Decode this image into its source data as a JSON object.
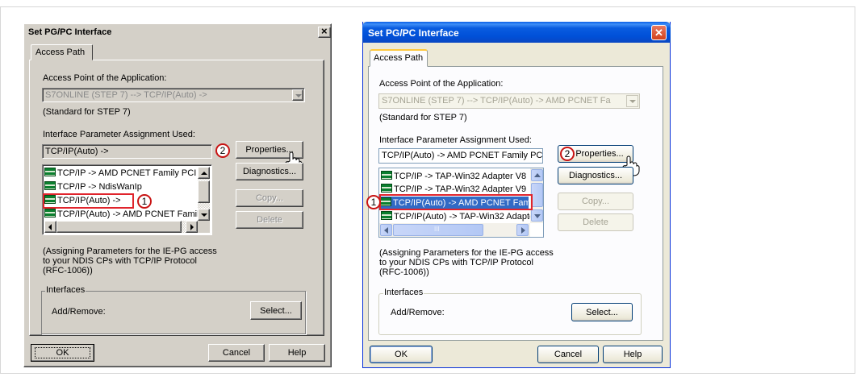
{
  "left_dialog": {
    "title": "Set PG/PC Interface",
    "close_glyph": "×",
    "tab": "Access Path",
    "access_point_label": "Access Point of the Application:",
    "access_point_value": "S7ONLINE      (STEP 7)      --> TCP/IP(Auto) ->",
    "standard_note": "(Standard for STEP 7)",
    "interface_param_label": "Interface Parameter Assignment Used:",
    "interface_param_value": "TCP/IP(Auto) ->",
    "list_items": [
      "TCP/IP -> AMD PCNET Family PCI",
      "TCP/IP -> NdisWanIp",
      "TCP/IP(Auto) ->",
      "TCP/IP(Auto) -> AMD PCNET Famil"
    ],
    "properties_button": "Properties...",
    "diagnostics_button": "Diagnostics...",
    "copy_button": "Copy...",
    "delete_button": "Delete",
    "info_text": "(Assigning Parameters for the IE-PG access\nto your NDIS CPs with TCP/IP Protocol\n(RFC-1006))",
    "interfaces_group": "Interfaces",
    "add_remove_label": "Add/Remove:",
    "select_button": "Select...",
    "ok_button": "OK",
    "cancel_button": "Cancel",
    "help_button": "Help",
    "callout_1": "1",
    "callout_2": "2"
  },
  "right_dialog": {
    "title": "Set PG/PC Interface",
    "close_glyph": "✕",
    "tab": "Access Path",
    "access_point_label": "Access Point of the Application:",
    "access_point_value": "S7ONLINE     (STEP 7)     --> TCP/IP(Auto) -> AMD PCNET Fa",
    "standard_note": "(Standard for STEP 7)",
    "interface_param_label": "Interface Parameter Assignment Used:",
    "interface_param_value": "TCP/IP(Auto) -> AMD PCNET Family PCI",
    "list_items": [
      "TCP/IP -> TAP-Win32 Adapter V8",
      "TCP/IP -> TAP-Win32 Adapter V9",
      "TCP/IP(Auto) -> AMD PCNET Fami",
      "TCP/IP(Auto) -> TAP-Win32 Adapte"
    ],
    "scroll_grip": "III",
    "properties_button": "Properties...",
    "diagnostics_button": "Diagnostics...",
    "copy_button": "Copy...",
    "delete_button": "Delete",
    "info_text": "(Assigning Parameters for the IE-PG access\nto your NDIS CPs with TCP/IP Protocol\n(RFC-1006))",
    "interfaces_group": "Interfaces",
    "add_remove_label": "Add/Remove:",
    "select_button": "Select...",
    "ok_button": "OK",
    "cancel_button": "Cancel",
    "help_button": "Help",
    "callout_1": "1",
    "callout_2": "2"
  },
  "colors": {
    "callout_border": "#c81414",
    "highlight_box": "#e0242c",
    "xp_selection": "#316ac5",
    "xp_title": "#0050d8"
  }
}
